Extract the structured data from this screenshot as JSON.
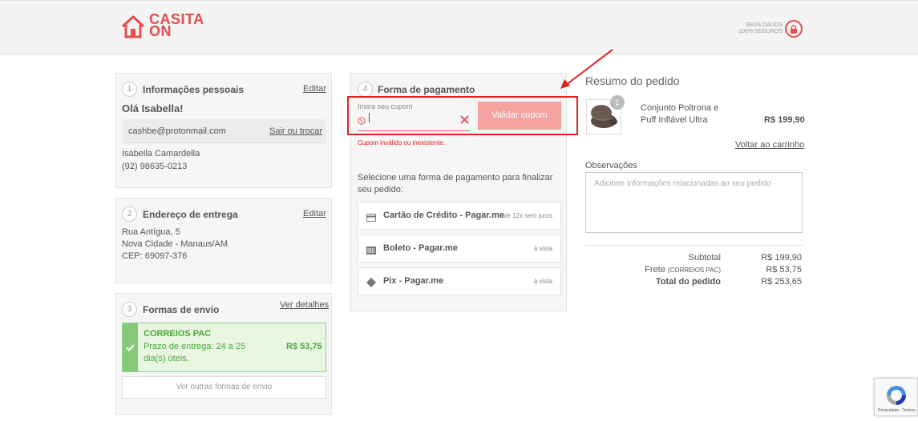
{
  "header": {
    "logo_line1": "CASITA",
    "logo_line2": "ON",
    "secure_line1": "SEUS DADOS",
    "secure_line2": "100% SEGUROS"
  },
  "personal": {
    "step": "1",
    "title": "Informações pessoais",
    "edit_label": "Editar",
    "greeting": "Olá Isabella!",
    "email": "cashbe@protonmail.com",
    "switch_label": "Sair ou trocar",
    "name": "Isabella Camardella",
    "phone": "(92) 98635-0213"
  },
  "address": {
    "step": "2",
    "title": "Endereço de entrega",
    "edit_label": "Editar",
    "line1": "Rua Antígua, 5",
    "line2": "Nova Cidade - Manaus/AM",
    "line3": "CEP: 69097-376"
  },
  "shipping": {
    "step": "3",
    "title": "Formas de envio",
    "details_label": "Ver detalhes",
    "option_name": "CORREIOS PAC",
    "option_desc_line1": "Prazo de entrega: 24 a 25",
    "option_desc_line2": "dia(s) úteis.",
    "option_price": "R$ 53,75",
    "other_label": "Ver outras formas de envio"
  },
  "payment": {
    "step": "4",
    "title": "Forma de pagamento",
    "coupon_label": "Insira seu cupom",
    "coupon_value": "",
    "validate_label": "Validar cupom",
    "coupon_error": "Cupom inválido ou inexistente.",
    "select_text": "Selecione uma forma de pagamento para finalizar seu pedido:",
    "options": [
      {
        "label": "Cartão de Crédito - Pagar.me",
        "note": "até 12x sem juros",
        "icon": "credit-card-icon"
      },
      {
        "label": "Boleto - Pagar.me",
        "note": "à vista",
        "icon": "barcode-icon"
      },
      {
        "label": "Pix - Pagar.me",
        "note": "à vista",
        "icon": "pix-icon"
      }
    ]
  },
  "summary": {
    "title": "Resumo do pedido",
    "product_qty": "1",
    "product_name_line1": "Conjunto Poltrona e",
    "product_name_line2": "Puff Inflável Ultra",
    "product_price": "R$ 199,90",
    "back_to_cart": "Voltar ao carrinho",
    "obs_label": "Observações",
    "obs_placeholder": "Adicione informações relacionadas ao seu pedido",
    "subtotal_label": "Subtotal",
    "subtotal_value": "R$ 199,90",
    "shipping_label": "Frete",
    "shipping_method": "(CORREIOS PAC)",
    "shipping_value": "R$ 53,75",
    "total_label": "Total do pedido",
    "total_value": "R$ 253,65"
  },
  "recaptcha": {
    "privacy": "Privacidade",
    "separator": " - ",
    "terms": "Termos"
  },
  "colors": {
    "brand": "#ea4b4b",
    "success": "#86c97a",
    "error": "#e02020"
  }
}
